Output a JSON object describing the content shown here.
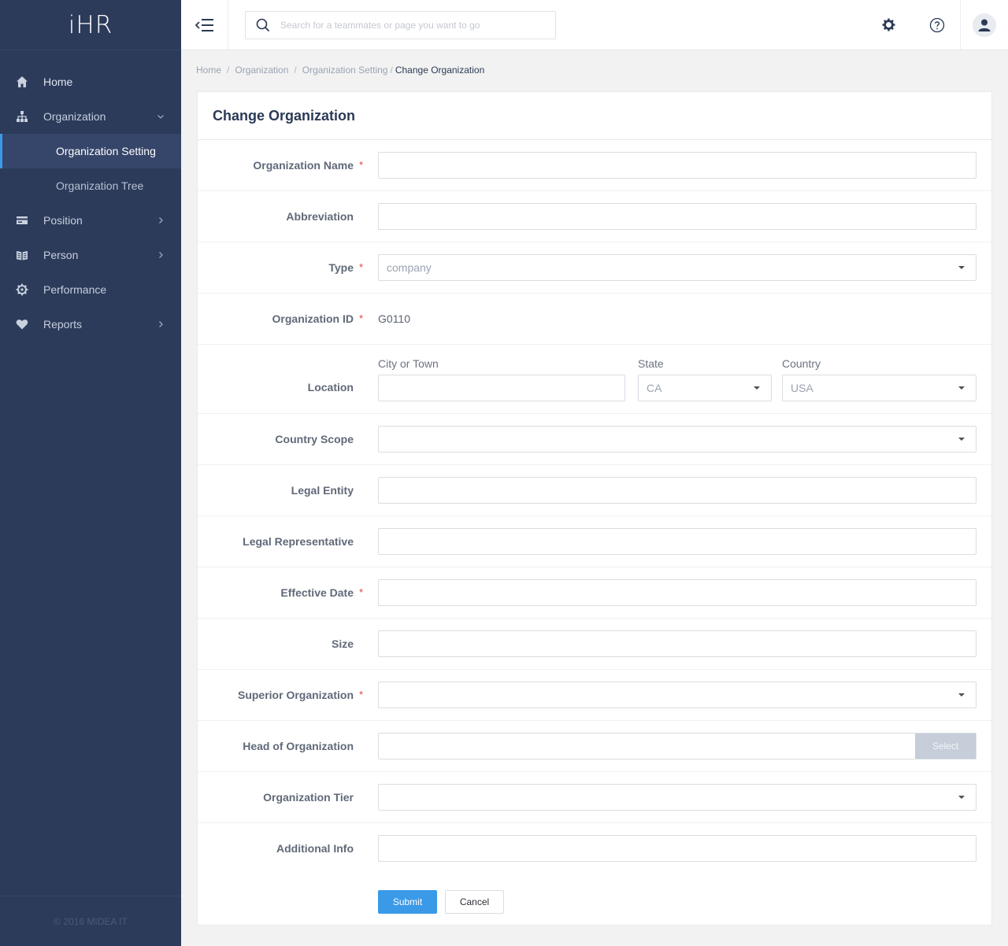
{
  "app": {
    "logo": "iHR",
    "footer": "© 2016 MIDEA IT"
  },
  "sidebar": {
    "items": [
      {
        "label": "Home",
        "icon": "home-icon"
      },
      {
        "label": "Organization",
        "icon": "org-chart-icon",
        "expanded": true,
        "children": [
          {
            "label": "Organization Setting",
            "active": true
          },
          {
            "label": "Organization Tree"
          }
        ]
      },
      {
        "label": "Position",
        "icon": "card-icon"
      },
      {
        "label": "Person",
        "icon": "book-icon"
      },
      {
        "label": "Performance",
        "icon": "gear-icon"
      },
      {
        "label": "Reports",
        "icon": "heart-icon"
      }
    ]
  },
  "header": {
    "search_placeholder": "Search for a teammates or page you want to go",
    "icons": [
      "menu-toggle-icon",
      "search-icon",
      "settings-icon",
      "help-icon",
      "user-icon"
    ]
  },
  "breadcrumb": {
    "items": [
      "Home",
      "Organization",
      "Organization Setting"
    ],
    "current": "Change Organization"
  },
  "form": {
    "title": "Change Organization",
    "fields": {
      "org_name": {
        "label": "Organization Name",
        "value": ""
      },
      "abbreviation": {
        "label": "Abbreviation",
        "value": ""
      },
      "type": {
        "label": "Type",
        "value": "company"
      },
      "org_id": {
        "label": "Organization ID",
        "value": "G0110"
      },
      "location": {
        "label": "Location",
        "city_label": "City or Town",
        "city_value": "",
        "state_label": "State",
        "state_value": "CA",
        "country_label": "Country",
        "country_value": "USA"
      },
      "country_scope": {
        "label": "Country Scope",
        "value": ""
      },
      "legal_entity": {
        "label": "Legal Entity",
        "value": ""
      },
      "legal_rep": {
        "label": "Legal Representative",
        "value": ""
      },
      "effective_date": {
        "label": "Effective Date",
        "value": ""
      },
      "size": {
        "label": "Size",
        "value": ""
      },
      "superior_org": {
        "label": "Superior Organization",
        "value": ""
      },
      "head_org": {
        "label": "Head of Organization",
        "value": "",
        "button": "Select"
      },
      "org_tier": {
        "label": "Organization Tier",
        "value": ""
      },
      "additional_info": {
        "label": "Additional Info",
        "value": ""
      }
    },
    "required_mark": "*",
    "submit": "Submit",
    "cancel": "Cancel"
  },
  "colors": {
    "sidebar_bg": "#2c3b5a",
    "accent": "#3a9ae8",
    "required": "#e8413a"
  }
}
